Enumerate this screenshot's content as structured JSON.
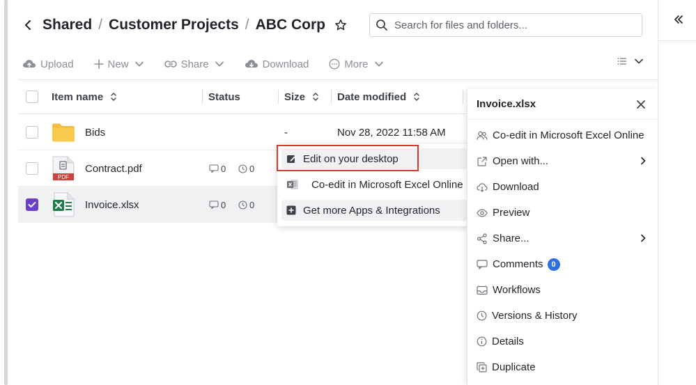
{
  "breadcrumb": {
    "items": [
      "Shared",
      "Customer Projects",
      "ABC Corp"
    ],
    "separator": "/"
  },
  "search": {
    "placeholder": "Search for files and folders..."
  },
  "toolbar": {
    "upload": "Upload",
    "new": "New",
    "share": "Share",
    "download": "Download",
    "more": "More"
  },
  "table": {
    "headers": {
      "name": "Item name",
      "status": "Status",
      "size": "Size",
      "date": "Date modified"
    },
    "rows": [
      {
        "name": "Bids",
        "type": "folder",
        "size": "-",
        "date": "Nov 28, 2022 11:58 AM",
        "comments": "",
        "versions": "",
        "selected": false
      },
      {
        "name": "Contract.pdf",
        "type": "pdf",
        "size": "",
        "date": "",
        "comments": "0",
        "versions": "0",
        "selected": false,
        "file_badge": "PDF"
      },
      {
        "name": "Invoice.xlsx",
        "type": "xlsx",
        "size": "",
        "date": "",
        "comments": "0",
        "versions": "0",
        "selected": true
      }
    ]
  },
  "context_menu": {
    "items": [
      {
        "label": "Edit on your desktop",
        "icon": "edit-desktop-icon"
      },
      {
        "label": "Co-edit in Microsoft Excel Online",
        "icon": "excel-online-icon"
      },
      {
        "label": "Get more Apps & Integrations",
        "icon": "plus-square-icon"
      }
    ]
  },
  "panel": {
    "title": "Invoice.xlsx",
    "items": [
      {
        "label": "Co-edit in Microsoft Excel Online"
      },
      {
        "label": "Open with..."
      },
      {
        "label": "Download"
      },
      {
        "label": "Preview"
      },
      {
        "label": "Share..."
      },
      {
        "label": "Comments",
        "badge": "0"
      },
      {
        "label": "Workflows"
      },
      {
        "label": "Versions & History"
      },
      {
        "label": "Details"
      },
      {
        "label": "Duplicate"
      }
    ]
  },
  "colors": {
    "accent_purple": "#6b3fc9",
    "highlight_red": "#d9382b",
    "badge_blue": "#2f6fe0",
    "excel_green": "#1f7a45",
    "pdf_red": "#c8463d",
    "folder_yellow": "#f5bf3d"
  }
}
